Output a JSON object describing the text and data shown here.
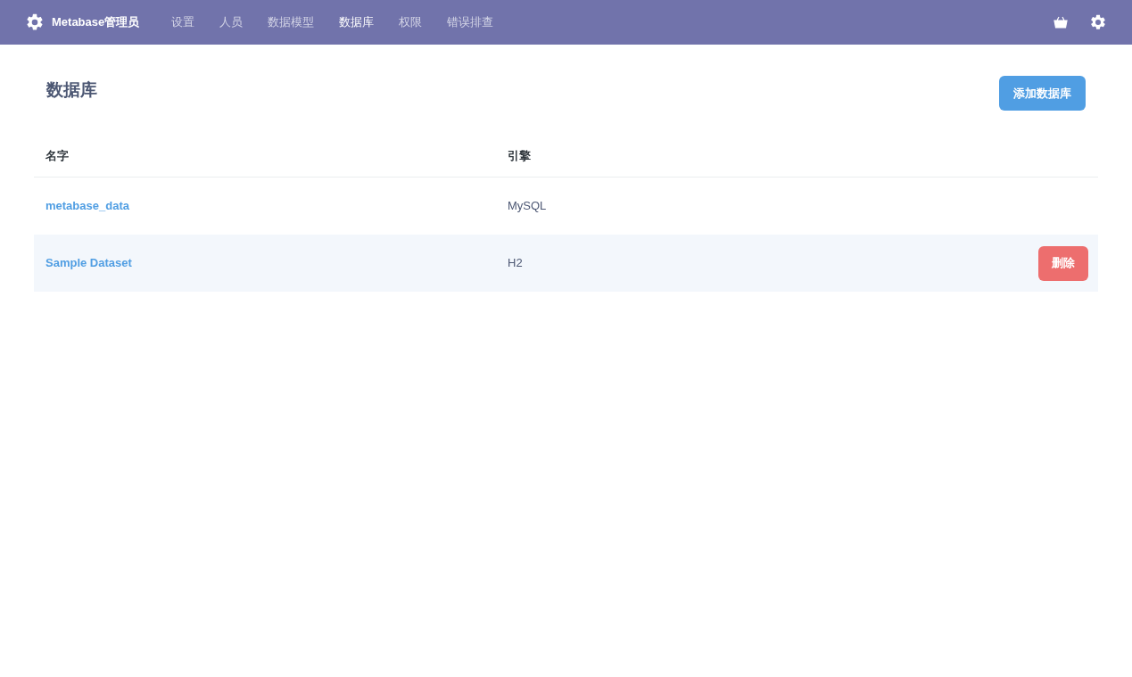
{
  "nav": {
    "brand": "Metabase管理员",
    "items": [
      {
        "label": "设置",
        "selected": false
      },
      {
        "label": "人员",
        "selected": false
      },
      {
        "label": "数据模型",
        "selected": false
      },
      {
        "label": "数据库",
        "selected": true
      },
      {
        "label": "权限",
        "selected": false
      },
      {
        "label": "错误排查",
        "selected": false
      }
    ]
  },
  "page": {
    "title": "数据库",
    "add_button": "添加数据库"
  },
  "table": {
    "columns": [
      "名字",
      "引擎"
    ],
    "rows": [
      {
        "name": "metabase_data",
        "engine": "MySQL",
        "highlighted": false
      },
      {
        "name": "Sample Dataset",
        "engine": "H2",
        "highlighted": true,
        "action": "删除"
      }
    ]
  }
}
